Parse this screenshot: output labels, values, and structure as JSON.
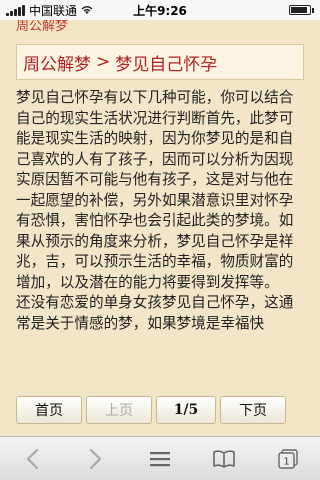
{
  "status_bar": {
    "carrier": "中国联通",
    "time": "上午9:26",
    "battery_level": 0.9
  },
  "header": {
    "site_title": "周公解梦"
  },
  "breadcrumb": {
    "home": "周公解梦",
    "separator": ">",
    "current": "梦见自己怀孕"
  },
  "article": {
    "paragraphs": [
      "梦见自己怀孕有以下几种可能，你可以结合自己的现实生活状况进行判断首先，此梦可能是现实生活的映射，因为你梦见的是和自己喜欢的人有了孩子，因而可以分析为因现实原因暂不可能与他有孩子，这是对与他在一起愿望的补偿，另外如果潜意识里对怀孕有恐惧，害怕怀孕也会引起此类的梦境。如果从预示的角度来分析，梦见自己怀孕是祥兆，吉，可以预示生活的幸福，物质财富的增加，以及潜在的能力将要得到发挥等。",
      "还没有恋爱的单身女孩梦见自己怀孕，这通常是关于情感的梦，如果梦境是幸福快"
    ]
  },
  "pager": {
    "first": "首页",
    "prev": "上页",
    "count": "1/5",
    "next": "下页"
  },
  "toolbar": {
    "icons": [
      "back-arrow-icon",
      "forward-arrow-icon",
      "share-icon",
      "bookmarks-icon",
      "tabs-icon"
    ],
    "tabs_count": "1"
  },
  "colors": {
    "page_bg": "#f3e6c8",
    "accent": "#b22222"
  }
}
